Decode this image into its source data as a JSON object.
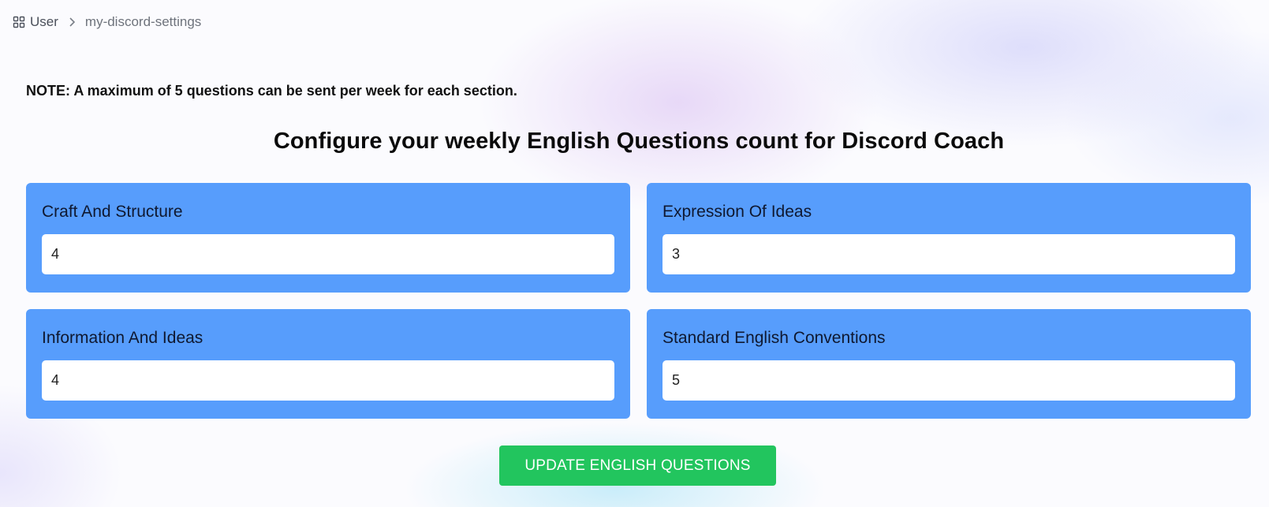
{
  "breadcrumb": {
    "icon": "grid-icon",
    "root": "User",
    "separator_icon": "chevron-right-icon",
    "current": "my-discord-settings"
  },
  "note": "NOTE: A maximum of 5 questions can be sent per week for each section.",
  "title": "Configure your weekly English Questions count for Discord Coach",
  "sections": [
    {
      "label": "Craft And Structure",
      "value": "4"
    },
    {
      "label": "Expression Of Ideas",
      "value": "3"
    },
    {
      "label": "Information And Ideas",
      "value": "4"
    },
    {
      "label": "Standard English Conventions",
      "value": "5"
    }
  ],
  "update_button_label": "UPDATE ENGLISH QUESTIONS",
  "colors": {
    "card_background": "#579dfc",
    "button_background": "#22c55e",
    "button_text": "#ffffff"
  }
}
